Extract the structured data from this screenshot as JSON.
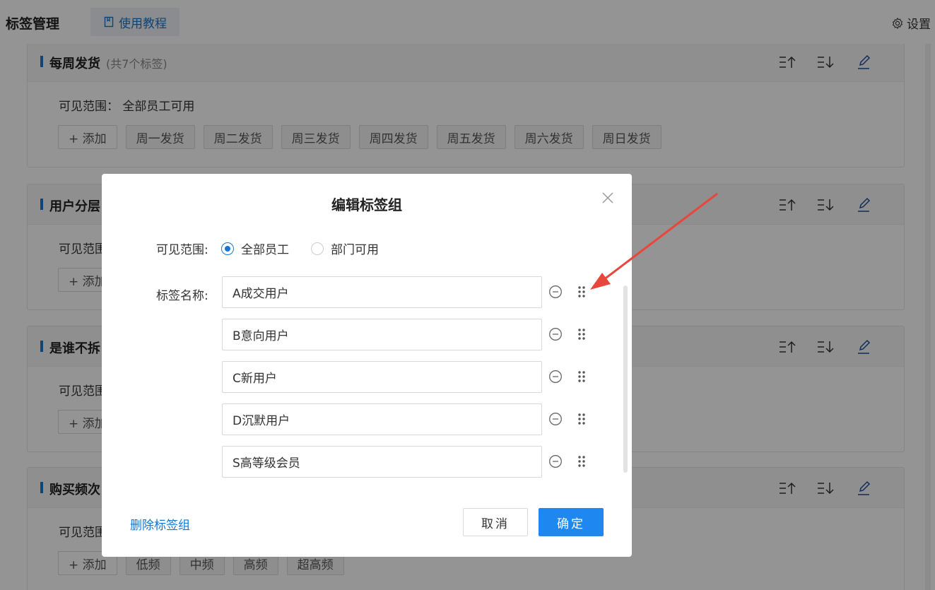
{
  "header": {
    "title": "标签管理",
    "tutorial_label": "使用教程",
    "settings_label": "设置"
  },
  "groups": [
    {
      "title": "每周发货",
      "count": "(共7个标签)",
      "scope": "可见范围：  全部员工可用",
      "add_label": "+ 添加",
      "tags": [
        "周一发货",
        "周二发货",
        "周三发货",
        "周四发货",
        "周五发货",
        "周六发货",
        "周日发货"
      ]
    },
    {
      "title": "用户分层",
      "scope": "可见范围",
      "add_label": "+ 添加"
    },
    {
      "title": "是谁不拆",
      "scope": "可见范围",
      "add_label": "+ 添加"
    },
    {
      "title": "购买频次",
      "scope": "可见范围",
      "add_label": "+ 添加",
      "tags": [
        "低频",
        "中频",
        "高频",
        "超高频"
      ]
    }
  ],
  "modal": {
    "title": "编辑标签组",
    "scope_label": "可见范围:",
    "scope_options": [
      {
        "label": "全部员工",
        "selected": true
      },
      {
        "label": "部门可用",
        "selected": false
      }
    ],
    "name_label": "标签名称:",
    "tag_names": [
      "A成交用户",
      "B意向用户",
      "C新用户",
      "D沉默用户",
      "S高等级会员"
    ],
    "delete_label": "删除标签组",
    "cancel_label": "取消",
    "confirm_label": "确定"
  },
  "colors": {
    "accent": "#1677d2",
    "primary_button": "#1e88f0",
    "annotation_arrow": "#e8473b"
  }
}
